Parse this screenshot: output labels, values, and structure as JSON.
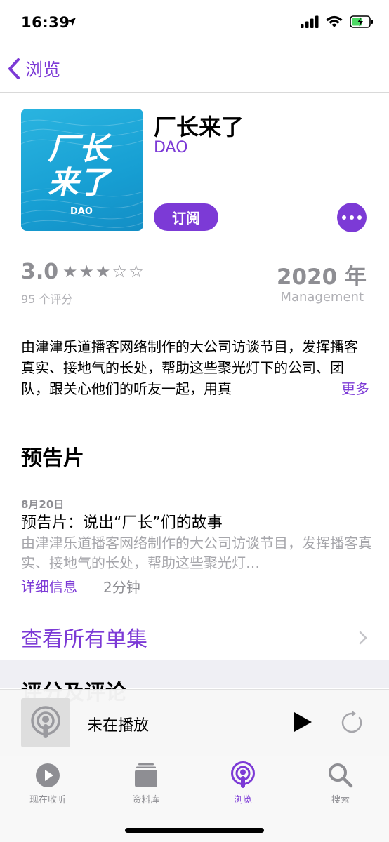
{
  "status_bar": {
    "time": "16:39",
    "icons": [
      "location-arrow-icon",
      "signal-icon",
      "wifi-icon",
      "battery-charging-icon"
    ]
  },
  "nav": {
    "back_label": "浏览",
    "back_icon": "chevron-left-icon"
  },
  "podcast": {
    "title": "厂长来了",
    "author": "DAO",
    "artwork_text": "厂长来了",
    "artwork_brand": "DAO",
    "subscribe_label": "订阅",
    "more_icon": "ellipsis-icon"
  },
  "ratings": {
    "value": "3.0",
    "stars": 3,
    "max_stars": 5,
    "count_label": "95 个评分"
  },
  "year": {
    "value": "2020 年",
    "category": "Management"
  },
  "description": {
    "text": "由津津乐道播客网络制作的大公司访谈节目，发挥播客真实、接地气的长处，帮助这些聚光灯下的公司、团队，跟关心他们的听友一起，用真",
    "more_label": "更多"
  },
  "trailer_section": {
    "title": "预告片",
    "episode": {
      "date": "8月20日",
      "title": "预告片：说出“厂长”们的故事",
      "description": "由津津乐道播客网络制作的大公司访谈节目，发挥播客真实、接地气的长处，帮助这些聚光灯…",
      "details_label": "详细信息",
      "duration": "2分钟"
    }
  },
  "see_all": {
    "label": "查看所有单集"
  },
  "ratings_section": {
    "title": "评分及评论"
  },
  "mini_player": {
    "status": "未在播放"
  },
  "tab_bar": {
    "tabs": [
      {
        "label": "现在收听",
        "icon": "play-circle-icon",
        "active": false
      },
      {
        "label": "资料库",
        "icon": "library-icon",
        "active": false
      },
      {
        "label": "浏览",
        "icon": "podcasts-icon",
        "active": true
      },
      {
        "label": "搜索",
        "icon": "search-icon",
        "active": false
      }
    ]
  },
  "colors": {
    "accent": "#7c3ad6",
    "secondary_text": "#8e8e93",
    "artwork_bg": "#1aa3d6"
  }
}
